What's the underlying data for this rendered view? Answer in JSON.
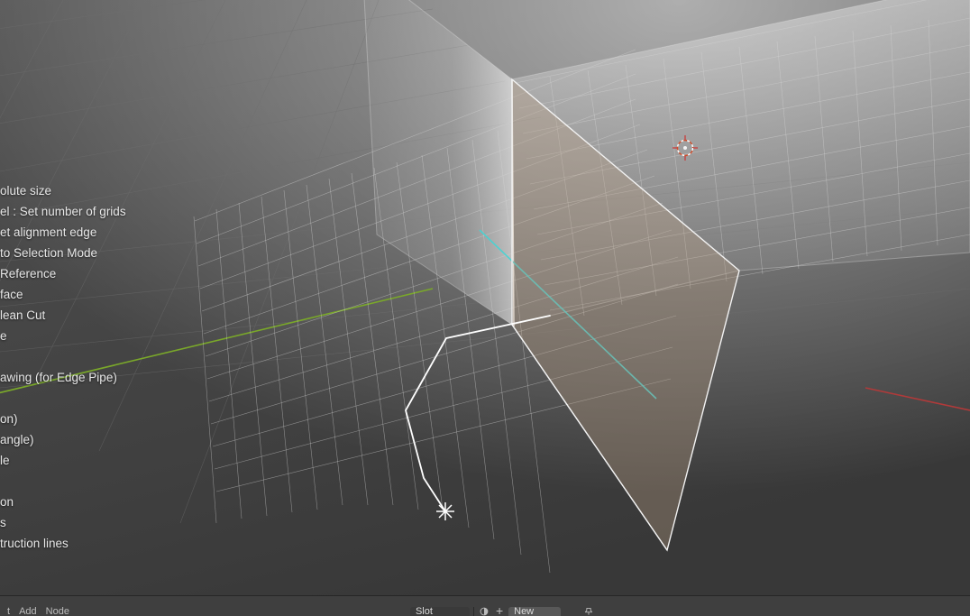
{
  "help_lines": [
    {
      "text": "olute size",
      "spaced": false
    },
    {
      "text": "el : Set number of grids",
      "spaced": false
    },
    {
      "text": "et alignment edge",
      "spaced": false
    },
    {
      "text": " to Selection Mode",
      "spaced": false
    },
    {
      "text": " Reference",
      "spaced": false
    },
    {
      "text": " face",
      "spaced": false
    },
    {
      "text": "lean Cut",
      "spaced": false
    },
    {
      "text": "e",
      "spaced": false
    },
    {
      "text": "",
      "spaced": true
    },
    {
      "text": "awing (for Edge Pipe)",
      "spaced": false
    },
    {
      "text": "",
      "spaced": true
    },
    {
      "text": "on)",
      "spaced": false
    },
    {
      "text": "angle)",
      "spaced": false
    },
    {
      "text": "le",
      "spaced": false
    },
    {
      "text": "",
      "spaced": true
    },
    {
      "text": "on",
      "spaced": false
    },
    {
      "text": "s",
      "spaced": false
    },
    {
      "text": "truction lines",
      "spaced": false
    }
  ],
  "bottom_bar": {
    "menu1": "t",
    "menu2": "Add",
    "menu3": "Node",
    "slot_label": "Slot",
    "button_label": "New"
  }
}
